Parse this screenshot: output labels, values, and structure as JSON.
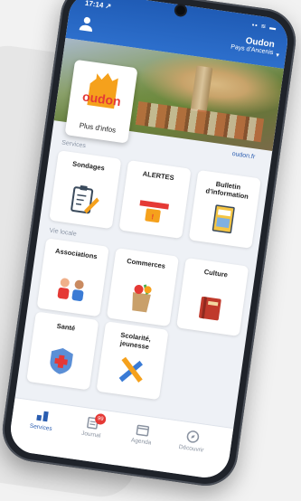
{
  "status": {
    "time": "17:14 ↗",
    "icons": "▪▪ ≋ ▬"
  },
  "header": {
    "town_name": "Oudon",
    "town_region": "Pays d'Ancenis"
  },
  "logo": {
    "wordmark": "oudon",
    "caption": "Plus d'infos"
  },
  "site_link": "oudon.fr",
  "sections": {
    "services": "Services",
    "vie_locale": "Vie locale"
  },
  "tiles": {
    "sondages": {
      "label": "Sondages",
      "icon": "clipboard-pencil-icon"
    },
    "alertes": {
      "label": "ALERTES",
      "icon": "alert-banner-icon"
    },
    "bulletin": {
      "label": "Bulletin d'information",
      "icon": "magazine-icon"
    },
    "associations": {
      "label": "Associations",
      "icon": "people-icon"
    },
    "commerces": {
      "label": "Commerces",
      "icon": "grocery-bag-icon"
    },
    "culture": {
      "label": "Culture",
      "icon": "book-icon"
    },
    "sante": {
      "label": "Santé",
      "icon": "medical-shield-icon"
    },
    "scolarite": {
      "label": "Scolarité, jeunesse",
      "icon": "pencil-ruler-icon"
    }
  },
  "tabs": {
    "services": "Services",
    "journal": "Journal",
    "journal_badge": "99",
    "agenda": "Agenda",
    "decouvrir": "Découvrir"
  },
  "colors": {
    "header_blue": "#2d6fcc",
    "accent_red": "#e53935",
    "brand_orange": "#f5a11c"
  }
}
